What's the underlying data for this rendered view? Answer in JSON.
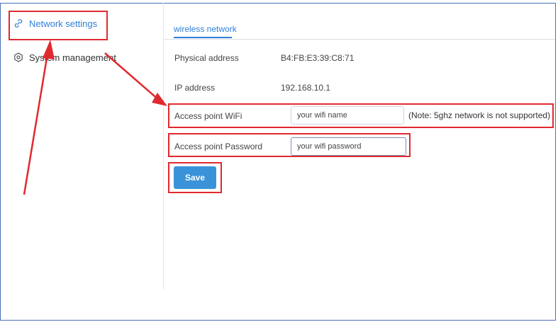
{
  "sidebar": {
    "items": [
      {
        "label": "Network settings",
        "icon": "link-icon",
        "active": true
      },
      {
        "label": "System management",
        "icon": "hexagon-gear-icon",
        "active": false
      }
    ]
  },
  "tabs": [
    {
      "label": "wireless network",
      "active": true
    }
  ],
  "form": {
    "physical_address_label": "Physical address",
    "physical_address_value": "B4:FB:E3:39:C8:71",
    "ip_address_label": "IP address",
    "ip_address_value": "192.168.10.1",
    "wifi_label": "Access point WiFi",
    "wifi_value": "your wifi name",
    "wifi_note": "(Note: 5ghz network is not supported)",
    "password_label": "Access point Password",
    "password_value": "your wifi password",
    "save_label": "Save"
  },
  "colors": {
    "accent": "#2f7fd8",
    "button": "#3a93d9",
    "annotation": "#e0292f",
    "frame": "#4a6fb5"
  }
}
